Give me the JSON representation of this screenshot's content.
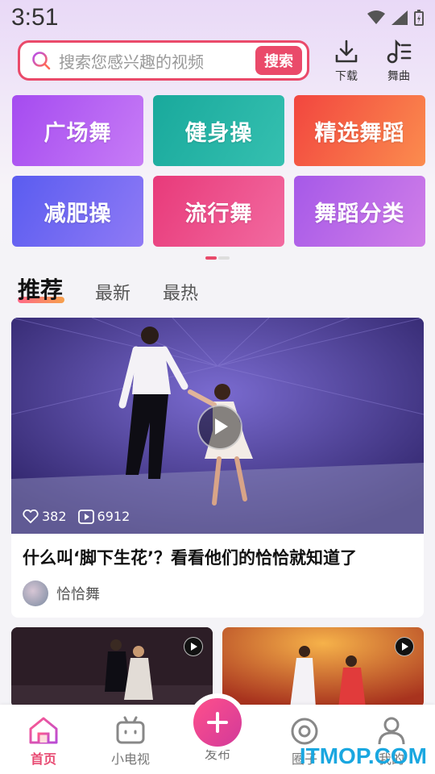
{
  "status_bar": {
    "time": "3:51"
  },
  "search": {
    "placeholder": "搜索您感兴趣的视频",
    "button_label": "搜索"
  },
  "top_actions": [
    {
      "label": "下载",
      "icon": "download-icon"
    },
    {
      "label": "舞曲",
      "icon": "music-icon"
    }
  ],
  "categories": [
    {
      "label": "广场舞",
      "color_from": "#a54bf0",
      "color_to": "#c77cf6"
    },
    {
      "label": "健身操",
      "color_from": "#19a99c",
      "color_to": "#35c0b0"
    },
    {
      "label": "精选舞蹈",
      "color_from": "#f2463f",
      "color_to": "#fb8c4e"
    },
    {
      "label": "减肥操",
      "color_from": "#5a5cf0",
      "color_to": "#8f7af5"
    },
    {
      "label": "流行舞",
      "color_from": "#e83a7a",
      "color_to": "#f26aa0"
    },
    {
      "label": "舞蹈分类",
      "color_from": "#a659e8",
      "color_to": "#d07ee8"
    }
  ],
  "tabs": [
    "推荐",
    "最新",
    "最热"
  ],
  "feature": {
    "likes": "382",
    "plays": "6912",
    "title": "什么叫‘脚下生花’？看看他们的恰恰就知道了",
    "author": "恰恰舞"
  },
  "nav": [
    {
      "label": "首页",
      "icon": "home-icon",
      "active": true
    },
    {
      "label": "小电视",
      "icon": "tv-icon"
    },
    {
      "label": "发布",
      "icon": "plus-icon"
    },
    {
      "label": "圈子",
      "icon": "circle-icon"
    },
    {
      "label": "我的",
      "icon": "user-icon"
    }
  ],
  "watermark": "ITMOP.COM"
}
